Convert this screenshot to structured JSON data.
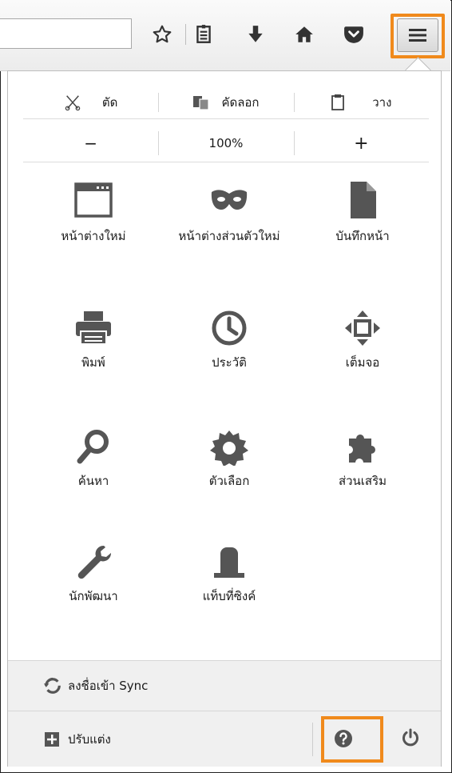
{
  "toolbar": {
    "icons": [
      "bookmark-star-icon",
      "reading-list-icon",
      "download-icon",
      "home-icon",
      "pocket-icon"
    ],
    "menu_button_icon": "hamburger-menu-icon",
    "highlight_color": "#f08a1c"
  },
  "edit": {
    "cut": "ตัด",
    "copy": "คัดลอก",
    "paste": "วาง"
  },
  "zoom": {
    "minus": "−",
    "level": "100%",
    "plus": "+"
  },
  "items": [
    {
      "label": "หน้าต่างใหม่",
      "icon": "new-window-icon"
    },
    {
      "label": "หน้าต่างส่วนตัวใหม่",
      "icon": "private-mask-icon"
    },
    {
      "label": "บันทึกหน้า",
      "icon": "save-page-icon"
    },
    {
      "label": "พิมพ์",
      "icon": "printer-icon"
    },
    {
      "label": "ประวัติ",
      "icon": "history-clock-icon"
    },
    {
      "label": "เต็มจอ",
      "icon": "fullscreen-icon"
    },
    {
      "label": "ค้นหา",
      "icon": "search-icon"
    },
    {
      "label": "ตัวเลือก",
      "icon": "options-gear-icon"
    },
    {
      "label": "ส่วนเสริม",
      "icon": "addons-puzzle-icon"
    },
    {
      "label": "นักพัฒนา",
      "icon": "developer-wrench-icon"
    },
    {
      "label": "แท็บที่ซิงค์",
      "icon": "synced-tabs-icon"
    }
  ],
  "sync": {
    "label": "ลงชื่อเข้า Sync",
    "icon": "sync-icon"
  },
  "customize": {
    "label": "ปรับแต่ง",
    "icon": "plus-square-icon"
  },
  "footer": {
    "help_icon": "help-icon",
    "quit_icon": "power-icon"
  }
}
